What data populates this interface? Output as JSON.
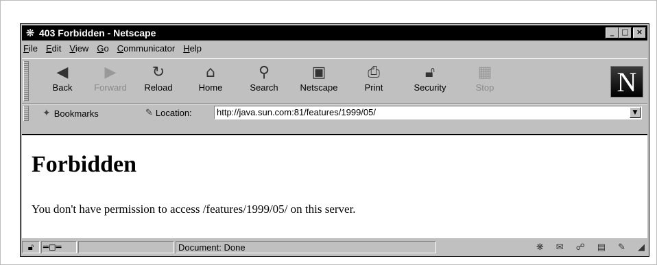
{
  "window": {
    "title": "403 Forbidden - Netscape",
    "buttons": {
      "minimize": "_",
      "maximize": "□",
      "close": "×"
    }
  },
  "menu": [
    {
      "label": "File",
      "key": "F",
      "rest": "ile"
    },
    {
      "label": "Edit",
      "key": "E",
      "rest": "dit"
    },
    {
      "label": "View",
      "key": "V",
      "rest": "iew"
    },
    {
      "label": "Go",
      "key": "G",
      "rest": "o"
    },
    {
      "label": "Communicator",
      "key": "C",
      "rest": "ommunicator"
    },
    {
      "label": "Help",
      "key": "H",
      "rest": "elp"
    }
  ],
  "toolbar": {
    "back": "Back",
    "forward": "Forward",
    "reload": "Reload",
    "home": "Home",
    "search": "Search",
    "netscape": "Netscape",
    "print": "Print",
    "security": "Security",
    "stop": "Stop",
    "logo": "N"
  },
  "location": {
    "bookmarks_label": "Bookmarks",
    "location_label": "Location:",
    "url": "http://java.sun.com:81/features/1999/05/"
  },
  "page": {
    "heading": "Forbidden",
    "message": "You don't have permission to access /features/1999/05/ on this server."
  },
  "status": {
    "text": "Document: Done"
  },
  "icons": {
    "app": "netscape-snowflake-icon",
    "back": "back-arrow-icon",
    "forward": "forward-arrow-icon",
    "reload": "reload-icon",
    "home": "home-icon",
    "search": "search-flashlight-icon",
    "netscape": "my-netscape-icon",
    "print": "printer-icon",
    "security": "padlock-icon",
    "stop": "stop-icon"
  }
}
